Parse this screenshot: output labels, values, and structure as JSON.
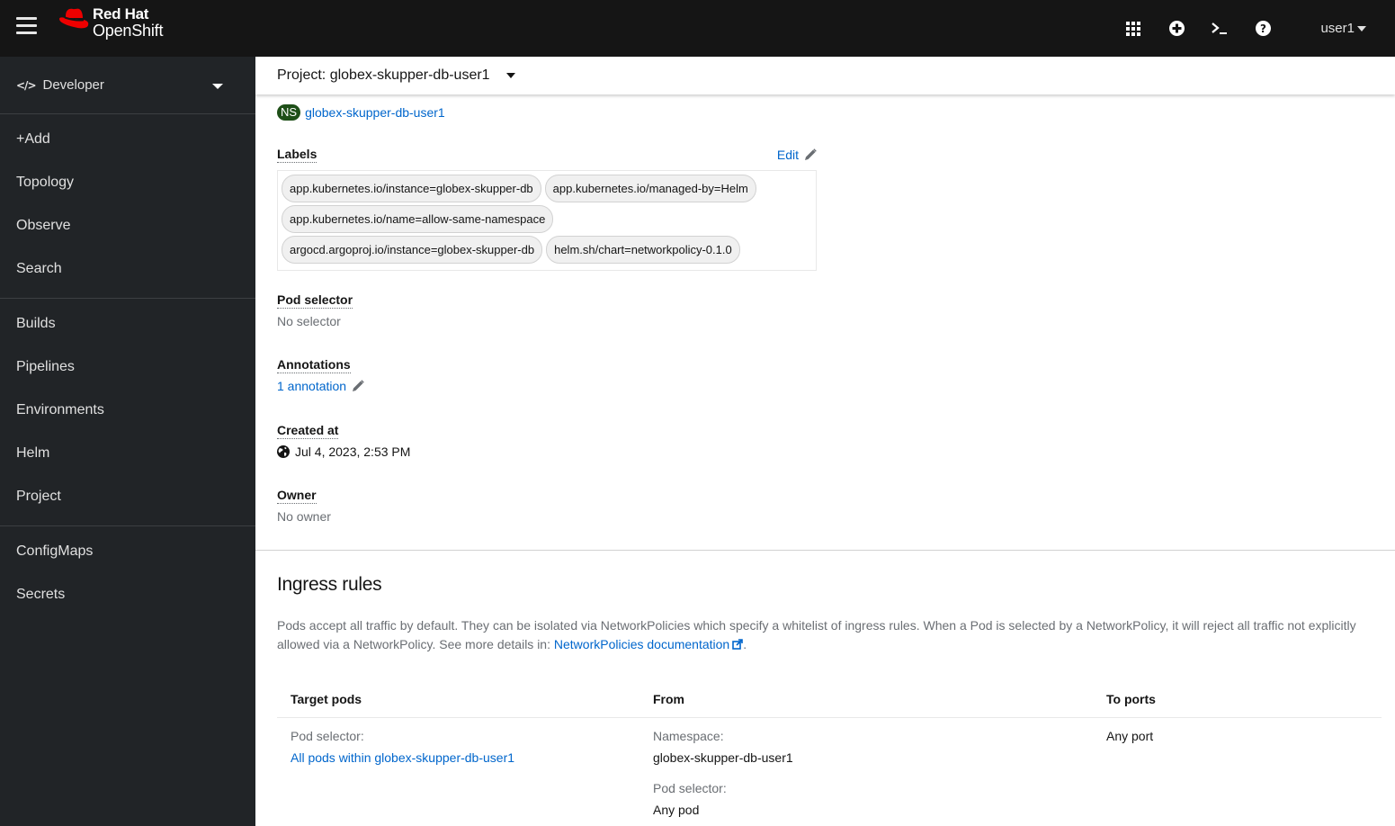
{
  "masthead": {
    "brand_line1": "Red Hat",
    "brand_line2": "OpenShift",
    "icons": [
      "apps-grid-icon",
      "plus-circle-icon",
      "terminal-icon",
      "help-circle-icon"
    ],
    "user": "user1"
  },
  "sidebar": {
    "perspective": "Developer",
    "groups": [
      [
        "+Add",
        "Topology",
        "Observe",
        "Search"
      ],
      [
        "Builds",
        "Pipelines",
        "Environments",
        "Helm",
        "Project"
      ],
      [
        "ConfigMaps",
        "Secrets"
      ]
    ]
  },
  "project_bar": {
    "label": "Project: globex-skupper-db-user1"
  },
  "details": {
    "namespace": {
      "badge": "NS",
      "name": "globex-skupper-db-user1"
    },
    "labels": {
      "title": "Labels",
      "edit": "Edit",
      "items": [
        "app.kubernetes.io/instance=globex-skupper-db",
        "app.kubernetes.io/managed-by=Helm",
        "app.kubernetes.io/name=allow-same-namespace",
        "argocd.argoproj.io/instance=globex-skupper-db",
        "helm.sh/chart=networkpolicy-0.1.0"
      ]
    },
    "pod_selector": {
      "title": "Pod selector",
      "value": "No selector"
    },
    "annotations": {
      "title": "Annotations",
      "value": "1 annotation"
    },
    "created_at": {
      "title": "Created at",
      "value": "Jul 4, 2023, 2:53 PM"
    },
    "owner": {
      "title": "Owner",
      "value": "No owner"
    }
  },
  "ingress": {
    "title": "Ingress rules",
    "description": "Pods accept all traffic by default. They can be isolated via NetworkPolicies which specify a whitelist of ingress rules. When a Pod is selected by a NetworkPolicy, it will reject all traffic not explicitly allowed via a NetworkPolicy. See more details in: ",
    "doc_link": "NetworkPolicies documentation",
    "doc_suffix": ".",
    "columns": [
      "Target pods",
      "From",
      "To ports"
    ],
    "rows": [
      {
        "target_label": "Pod selector:",
        "target_value": "All pods within globex-skupper-db-user1",
        "from_ns_label": "Namespace:",
        "from_ns_value": "globex-skupper-db-user1",
        "from_pod_label": "Pod selector:",
        "from_pod_value": "Any pod",
        "to_ports": "Any port"
      }
    ]
  }
}
